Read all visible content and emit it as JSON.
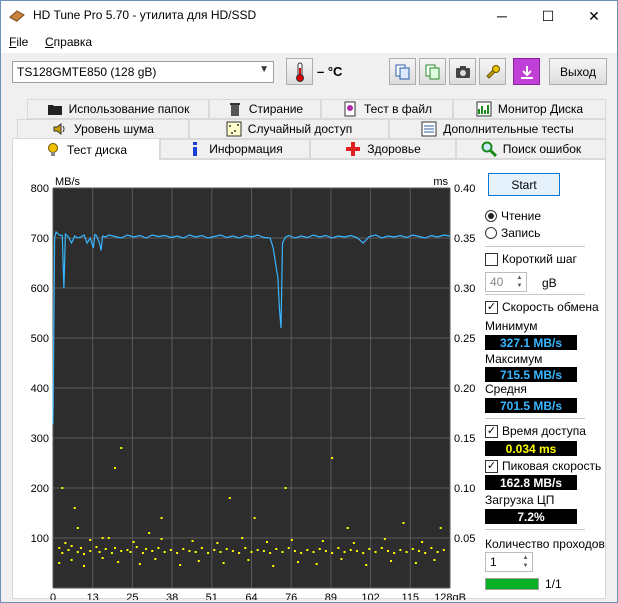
{
  "window": {
    "title": "HD Tune Pro 5.70 - утилита для HD/SSD",
    "minimize": "─",
    "maximize": "☐",
    "close": "✕"
  },
  "menu": {
    "file": "File",
    "file_hotkey": "F",
    "help": "Справка",
    "help_hotkey": "С"
  },
  "toolbar": {
    "drive": "TS128GMTE850 (128 gB)",
    "temperature": "– °C",
    "exit_label": "Выход",
    "icons": [
      "copy-icon",
      "copy-green-icon",
      "camera-icon",
      "tool-icon",
      "save-download-icon"
    ]
  },
  "tabs": {
    "row1": [
      {
        "label": "Использование папок",
        "icon": "folder-icon"
      },
      {
        "label": "Стирание",
        "icon": "trash-icon"
      },
      {
        "label": "Тест в файл",
        "icon": "file-test-icon"
      },
      {
        "label": "Монитор Диска",
        "icon": "monitor-icon"
      }
    ],
    "row2": [
      {
        "label": "Уровень шума",
        "icon": "speaker-icon"
      },
      {
        "label": "Случайный доступ",
        "icon": "random-icon"
      },
      {
        "label": "Дополнительные  тесты",
        "icon": "extra-tests-icon"
      }
    ],
    "row3": [
      {
        "label": "Тест диска",
        "icon": "bulb-icon",
        "active": true
      },
      {
        "label": "Информация",
        "icon": "info-icon"
      },
      {
        "label": "Здоровье",
        "icon": "health-cross-icon"
      },
      {
        "label": "Поиск ошибок",
        "icon": "search-icon"
      }
    ]
  },
  "panel": {
    "start": "Start",
    "read": "Чтение",
    "write": "Запись",
    "short_step": "Короткий шаг",
    "step_value": "40",
    "step_unit": "gB",
    "transfer_rate": "Скорость обмена",
    "minimum_label": "Минимум",
    "minimum_value": "327.1 MB/s",
    "maximum_label": "Максимум",
    "maximum_value": "715.5 MB/s",
    "average_label": "Средня",
    "average_value": "701.5 MB/s",
    "access_time_label": "Время доступа",
    "access_time_value": "0.034 ms",
    "burst_label": "Пиковая скорость",
    "burst_value": "162.8 MB/s",
    "cpu_label": "Загрузка ЦП",
    "cpu_value": "7.2%",
    "passes_label": "Количество проходов",
    "passes_value": "1",
    "progress_text": "1/1",
    "progress_fraction": 1.0,
    "value_color": "#38b6ff",
    "access_color": "#ffff00",
    "burst_color": "#ffffff"
  },
  "chart_data": {
    "type": "line",
    "ylabel_left": "MB/s",
    "ylabel_right": "ms",
    "ylim_left": [
      0,
      800
    ],
    "ylim_right": [
      0,
      0.4
    ],
    "yticks_left": [
      "800",
      "700",
      "600",
      "500",
      "400",
      "300",
      "200",
      "100"
    ],
    "yticks_right": [
      "0.40",
      "0.35",
      "0.30",
      "0.25",
      "0.20",
      "0.15",
      "0.10",
      "0.05"
    ],
    "xlim": [
      0,
      128
    ],
    "xticks": [
      "0",
      "13",
      "25",
      "38",
      "51",
      "64",
      "76",
      "89",
      "102",
      "115",
      "128gB"
    ],
    "grid": true,
    "background": "#2d2d2d",
    "series": [
      {
        "name": "transfer",
        "color": "#38b6ff",
        "x": [
          0,
          0.5,
          1,
          2,
          3,
          3.5,
          4,
          5,
          6,
          7,
          8,
          9,
          10,
          11,
          12,
          13,
          13.5,
          14,
          15,
          15.5,
          16,
          17,
          18,
          20,
          22,
          24,
          26,
          28,
          30,
          32,
          34,
          36,
          38,
          40,
          42,
          44,
          46,
          48,
          50,
          52,
          54,
          56,
          58,
          60,
          62,
          64,
          66,
          68,
          70,
          71,
          72,
          72.5,
          73,
          73.5,
          74,
          75,
          76,
          78,
          80,
          82,
          84,
          86,
          88,
          90,
          92,
          94,
          96,
          98,
          100,
          102,
          104,
          106,
          108,
          110,
          112,
          114,
          116,
          118,
          120,
          122,
          124,
          126,
          128
        ],
        "values": [
          327,
          700,
          712,
          706,
          705,
          600,
          708,
          702,
          690,
          704,
          700,
          702,
          706,
          690,
          700,
          680,
          707,
          705,
          690,
          675,
          704,
          702,
          706,
          703,
          700,
          706,
          702,
          705,
          700,
          706,
          703,
          705,
          701,
          704,
          700,
          706,
          702,
          705,
          700,
          703,
          706,
          701,
          704,
          700,
          705,
          702,
          706,
          701,
          700,
          680,
          640,
          620,
          560,
          520,
          690,
          702,
          705,
          700,
          704,
          701,
          706,
          702,
          705,
          700,
          704,
          702,
          705,
          701,
          690,
          703,
          706,
          700,
          704,
          702,
          705,
          701,
          706,
          703,
          700,
          705,
          702,
          706,
          704
        ]
      },
      {
        "name": "access",
        "type": "scatter",
        "color": "#ffff00",
        "axis": "right",
        "x": [
          2,
          3,
          5,
          6,
          8,
          9,
          10,
          12,
          14,
          15,
          17,
          19,
          20,
          22,
          24,
          25,
          27,
          29,
          30,
          32,
          34,
          36,
          38,
          40,
          42,
          44,
          46,
          48,
          50,
          52,
          54,
          56,
          58,
          60,
          62,
          64,
          66,
          68,
          70,
          72,
          74,
          76,
          78,
          80,
          82,
          84,
          86,
          88,
          90,
          92,
          94,
          96,
          98,
          100,
          102,
          104,
          106,
          108,
          110,
          112,
          114,
          116,
          118,
          120,
          122,
          124,
          126,
          2,
          6,
          10,
          16,
          21,
          28,
          33,
          41,
          47,
          55,
          63,
          71,
          79,
          85,
          93,
          101,
          109,
          117,
          123,
          4,
          12,
          18,
          26,
          35,
          45,
          53,
          61,
          69,
          77,
          87,
          97,
          107,
          119,
          20,
          3,
          7,
          57,
          75,
          35,
          22,
          90,
          8,
          16,
          31,
          65,
          95,
          113,
          125
        ],
        "values": [
          0.04,
          0.035,
          0.038,
          0.042,
          0.036,
          0.04,
          0.034,
          0.037,
          0.041,
          0.036,
          0.039,
          0.035,
          0.04,
          0.037,
          0.038,
          0.036,
          0.041,
          0.035,
          0.039,
          0.037,
          0.04,
          0.036,
          0.038,
          0.035,
          0.039,
          0.037,
          0.036,
          0.04,
          0.035,
          0.038,
          0.036,
          0.039,
          0.037,
          0.035,
          0.04,
          0.036,
          0.038,
          0.037,
          0.035,
          0.039,
          0.036,
          0.04,
          0.037,
          0.035,
          0.038,
          0.036,
          0.039,
          0.037,
          0.035,
          0.04,
          0.036,
          0.038,
          0.037,
          0.035,
          0.039,
          0.036,
          0.04,
          0.037,
          0.035,
          0.038,
          0.036,
          0.039,
          0.037,
          0.035,
          0.04,
          0.036,
          0.038,
          0.025,
          0.028,
          0.022,
          0.03,
          0.026,
          0.024,
          0.029,
          0.023,
          0.027,
          0.025,
          0.028,
          0.022,
          0.026,
          0.024,
          0.029,
          0.023,
          0.027,
          0.025,
          0.028,
          0.045,
          0.048,
          0.05,
          0.046,
          0.049,
          0.047,
          0.045,
          0.05,
          0.046,
          0.048,
          0.047,
          0.045,
          0.049,
          0.046,
          0.12,
          0.1,
          0.08,
          0.09,
          0.1,
          0.07,
          0.14,
          0.13,
          0.06,
          0.05,
          0.055,
          0.07,
          0.06,
          0.065,
          0.06
        ]
      }
    ]
  }
}
